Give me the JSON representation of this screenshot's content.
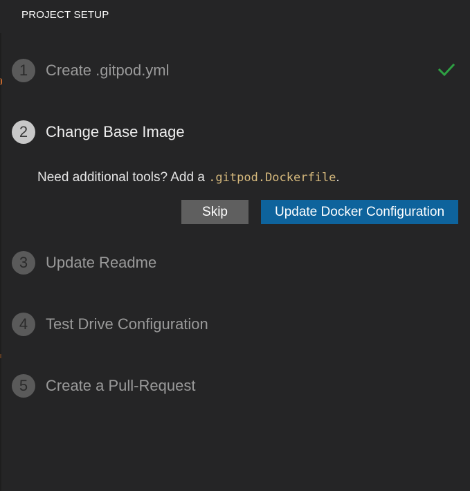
{
  "header": {
    "title": "PROJECT SETUP"
  },
  "steps": [
    {
      "number": "1",
      "label": "Create .gitpod.yml",
      "state": "done",
      "icon": "check-icon"
    },
    {
      "number": "2",
      "label": "Change Base Image",
      "state": "active"
    },
    {
      "number": "3",
      "label": "Update Readme",
      "state": "pending"
    },
    {
      "number": "4",
      "label": "Test Drive Configuration",
      "state": "pending"
    },
    {
      "number": "5",
      "label": "Create a Pull-Request",
      "state": "pending"
    }
  ],
  "active_step": {
    "description_prefix": "Need additional tools? Add a ",
    "description_code": ".gitpod.Dockerfile",
    "description_suffix": ".",
    "skip_label": "Skip",
    "primary_label": "Update Docker Configuration"
  },
  "colors": {
    "background": "#252526",
    "check": "#2ea043",
    "primary_button": "#0e639c",
    "secondary_button": "#5f5f5f",
    "code_text": "#d7ba7d"
  }
}
